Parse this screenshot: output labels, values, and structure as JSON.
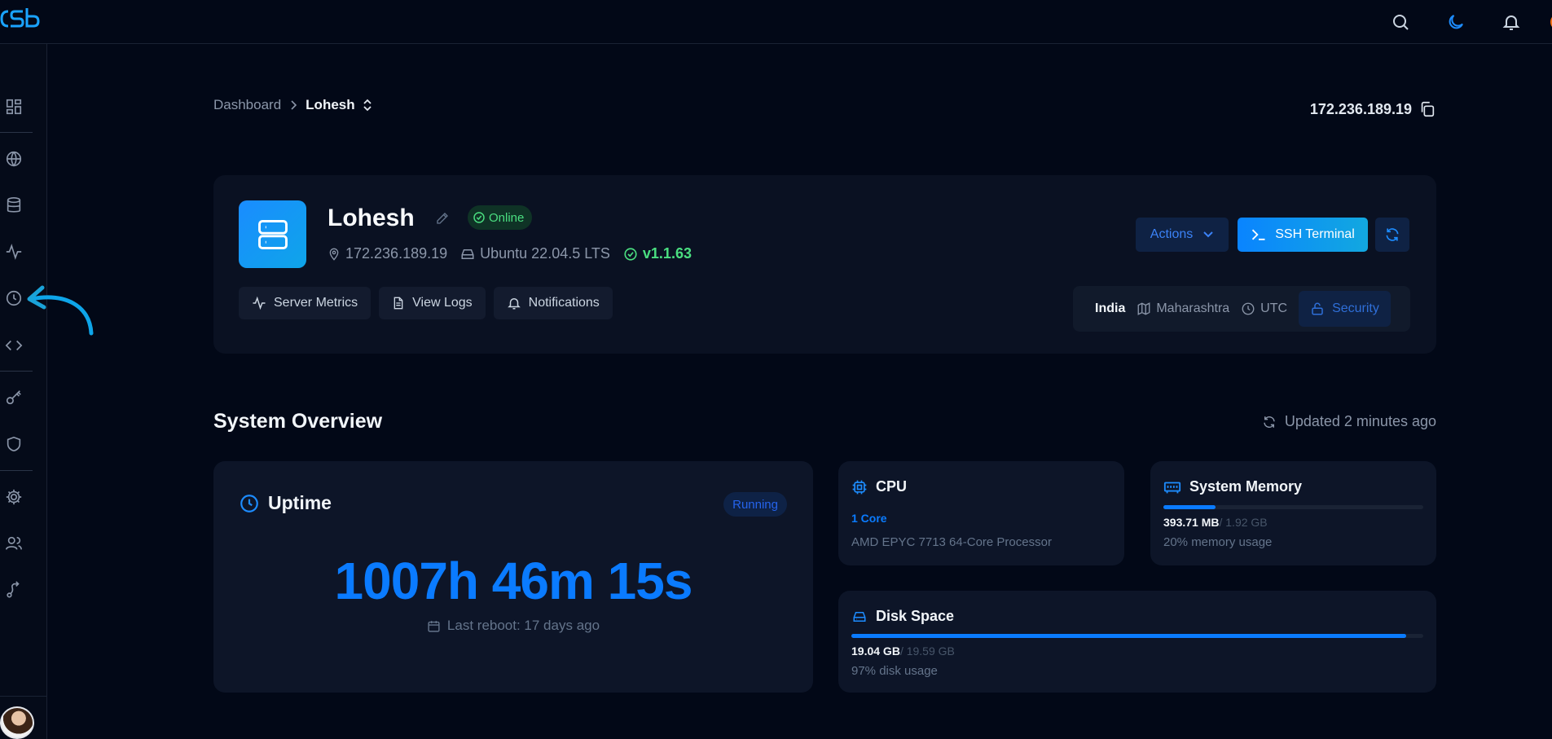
{
  "header": {
    "logo_text": "cSb"
  },
  "breadcrumb": {
    "root": "Dashboard",
    "current": "Lohesh"
  },
  "ip_address": "172.236.189.19",
  "server": {
    "name": "Lohesh",
    "status": "Online",
    "ip": "172.236.189.19",
    "os": "Ubuntu 22.04.5 LTS",
    "version": "v1.1.63",
    "quick_links": [
      "Server Metrics",
      "View Logs",
      "Notifications"
    ],
    "actions_label": "Actions",
    "ssh_label": "SSH Terminal",
    "location": {
      "country": "India",
      "region": "Maharashtra",
      "timezone": "UTC",
      "security_label": "Security"
    }
  },
  "overview": {
    "title": "System Overview",
    "updated": "Updated 2 minutes ago",
    "uptime": {
      "title": "Uptime",
      "badge": "Running",
      "value": "1007h 46m 15s",
      "last_reboot": "Last reboot: 17 days ago"
    },
    "cpu": {
      "title": "CPU",
      "cores": "1 Core",
      "model": "AMD EPYC 7713 64-Core Processor"
    },
    "memory": {
      "title": "System Memory",
      "used": "393.71 MB",
      "total": "/ 1.92 GB",
      "usage_pct": 20,
      "usage_text": "20% memory usage"
    },
    "disk": {
      "title": "Disk Space",
      "used": "19.04 GB",
      "total": "/ 19.59 GB",
      "usage_pct": 97,
      "usage_text": "97% disk usage"
    }
  },
  "colors": {
    "accent": "#0a7bff",
    "online": "#4ade80",
    "background": "#020817",
    "card": "#0d1528"
  }
}
